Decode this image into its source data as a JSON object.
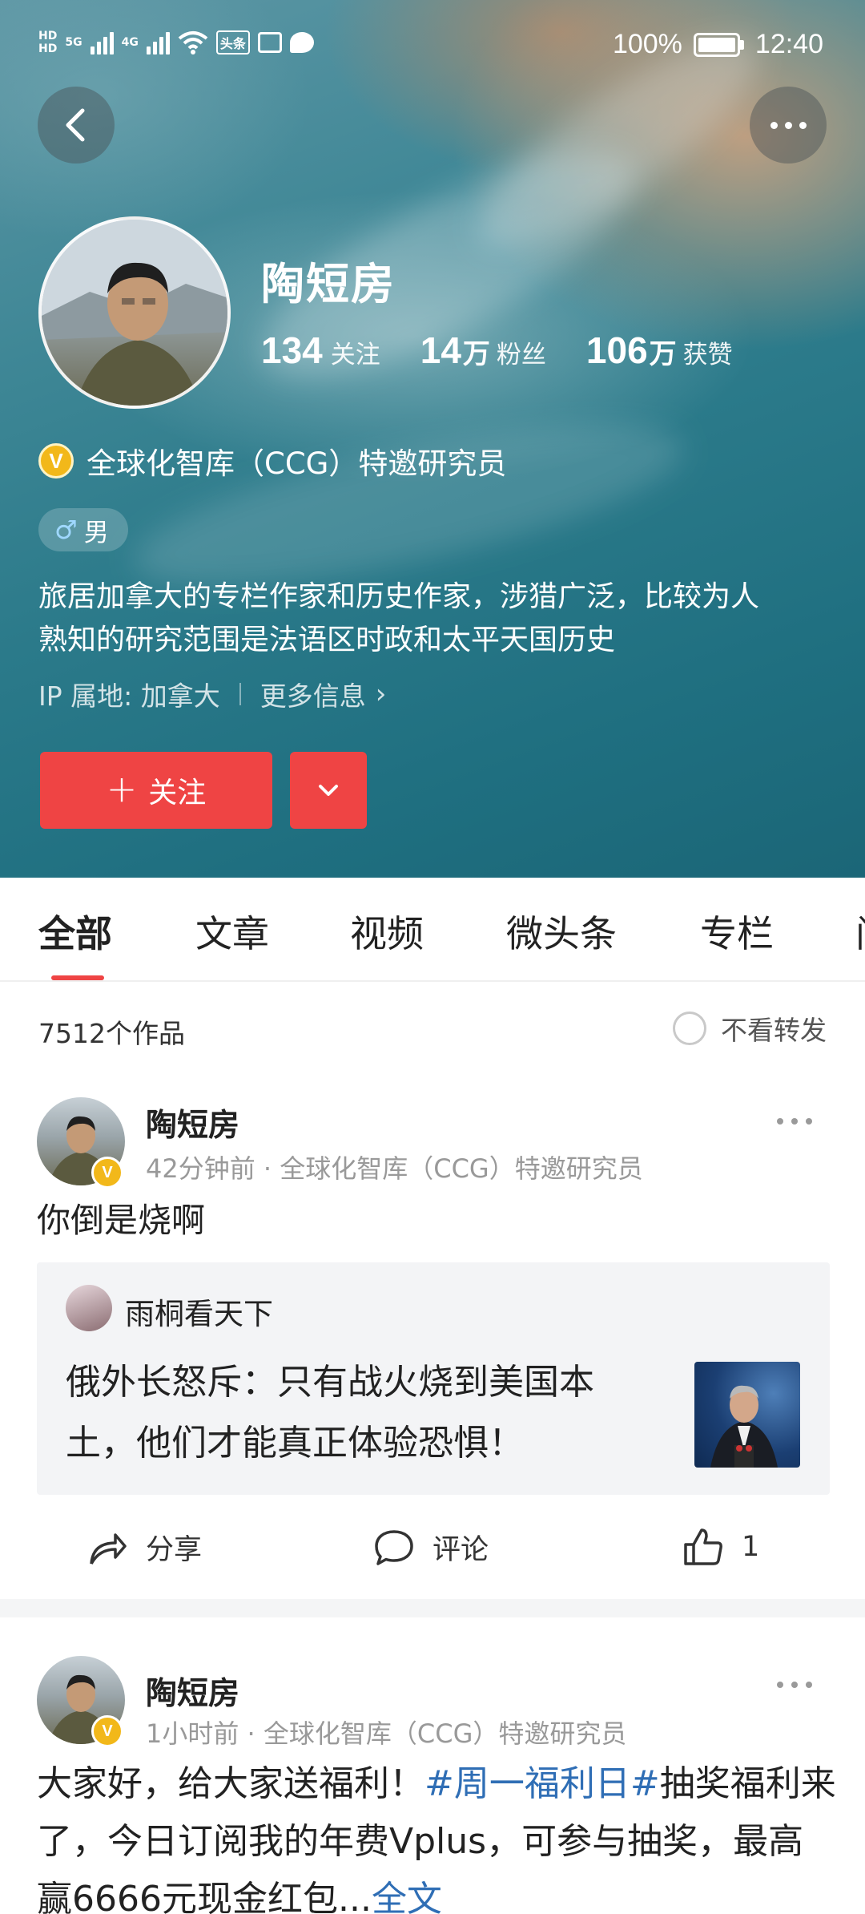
{
  "status_bar": {
    "network_labels": [
      "HD",
      "5G",
      "4G"
    ],
    "app_icon_label": "头条",
    "battery": "100%",
    "time": "12:40"
  },
  "profile": {
    "name": "陶短房",
    "stats": [
      {
        "num": "134",
        "unit": "",
        "label": "关注"
      },
      {
        "num": "14",
        "unit": "万",
        "label": "粉丝"
      },
      {
        "num": "106",
        "unit": "万",
        "label": "获赞"
      }
    ],
    "verify_badge": "V",
    "verification": "全球化智库（CCG）特邀研究员",
    "gender": "男",
    "bio_line1": "旅居加拿大的专栏作家和历史作家，涉猎广泛，比较为人",
    "bio_line2": "熟知的研究范围是法语区时政和太平天国历史",
    "ip": "IP 属地: 加拿大",
    "more_info": "更多信息",
    "follow_label": "关注"
  },
  "tabs": [
    "全部",
    "文章",
    "视频",
    "微头条",
    "专栏",
    "问"
  ],
  "works": {
    "count": "7512个作品",
    "hide_reposts": "不看转发"
  },
  "posts": [
    {
      "author": "陶短房",
      "meta": "42分钟前 · 全球化智库（CCG）特邀研究员",
      "text": "你倒是烧啊",
      "quote": {
        "author": "雨桐看天下",
        "text_line1": "俄外长怒斥：只有战火烧到美国本",
        "text_line2": "土，他们才能真正体验恐惧！"
      },
      "actions": {
        "share": "分享",
        "comment": "评论",
        "like_count": "1"
      }
    },
    {
      "author": "陶短房",
      "meta": "1小时前 · 全球化智库（CCG）特邀研究员",
      "text_part1": "大家好，给大家送福利！",
      "hashtag": "#周一福利日#",
      "text_part2": "抽奖福利来了，今日订阅我的年费Vplus，可参与抽奖，最高赢6666元现金红包...",
      "more": "全文"
    }
  ],
  "colors": {
    "accent": "#ef4444",
    "link": "#2f6eb5",
    "verify_gold": "#f2b81a"
  }
}
